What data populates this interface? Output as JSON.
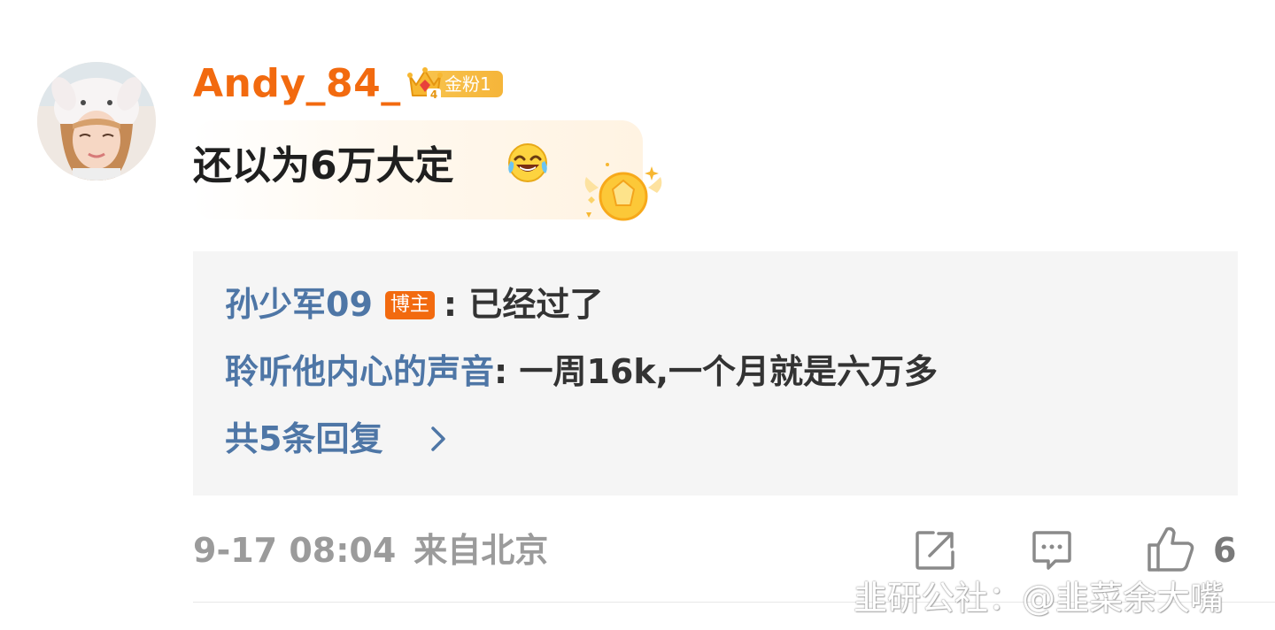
{
  "comment": {
    "username": "Andy_84_",
    "fan_badge_level": "4",
    "fan_badge_label": "金粉1",
    "text": "还以为6万大定",
    "emoji": "laughing-crying-emoji"
  },
  "replies": [
    {
      "user": "孙少军09",
      "badge": "博主",
      "separator": ": ",
      "text": "已经过了"
    },
    {
      "user": "聆听他内心的声音",
      "separator": ": ",
      "text": "一周16k,一个月就是六万多"
    }
  ],
  "more_replies_label": "共5条回复",
  "footer": {
    "time": "9-17 08:04",
    "location": "来自北京",
    "like_count": "6"
  },
  "watermark": "韭研公社：@韭菜余大嘴",
  "colors": {
    "username": "#f26a0f",
    "reply_user": "#4e76a6",
    "reply_bg": "#f5f5f5",
    "meta": "#9b9b9b",
    "host_badge": "#f26a0f",
    "fan_badge": "#f5b53a"
  },
  "icons": [
    "share-icon",
    "comment-icon",
    "like-icon",
    "chevron-right-icon",
    "crown-icon",
    "medal-icon"
  ]
}
